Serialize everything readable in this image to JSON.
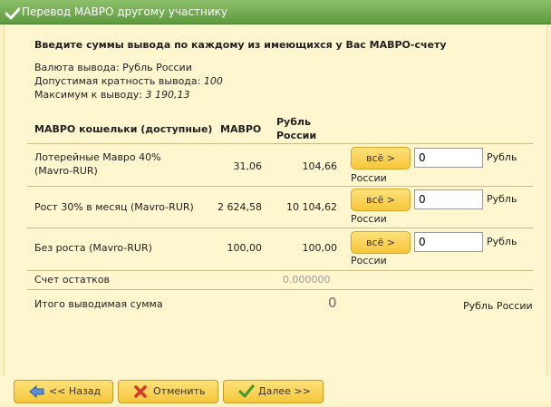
{
  "window": {
    "title": "Перевод МАВРО другому участнику"
  },
  "form": {
    "heading": "Введите суммы вывода по каждому из имеющихся у Вас МАВРО-счету",
    "currency_label": "Валюта вывода: Рубль России",
    "multiplicity_label": "Допустимая кратность вывода:",
    "multiplicity_value": "100",
    "maximum_label": "Максимум к выводу:",
    "maximum_value": "3 190,13"
  },
  "table": {
    "headers": {
      "wallets": "МАВРО кошельки (доступные)",
      "mavro": "МАВРО",
      "rub_line1": "Рубль",
      "rub_line2": "России"
    },
    "rows": [
      {
        "name_line1": "Лотерейные Мавро 40%",
        "name_line2": "(Mavro-RUR)",
        "mavro": "31,06",
        "rub": "104,66",
        "button": "всё >",
        "amount": "0",
        "currency_line1": "Рубль",
        "currency_line2": "России"
      },
      {
        "name_line1": "Рост 30% в месяц (Mavro-RUR)",
        "name_line2": "",
        "mavro": "2 624,58",
        "rub": "10 104,62",
        "button": "всё >",
        "amount": "0",
        "currency_line1": "Рубль",
        "currency_line2": "России"
      },
      {
        "name_line1": "Без роста (Mavro-RUR)",
        "name_line2": "",
        "mavro": "100,00",
        "rub": "100,00",
        "button": "всё >",
        "amount": "0",
        "currency_line1": "Рубль",
        "currency_line2": "России"
      }
    ],
    "balance": {
      "label": "Счет остатков",
      "value": "0.000000"
    },
    "total": {
      "label": "Итого выводимая сумма",
      "value": "0",
      "currency": "Рубль России"
    }
  },
  "buttons": {
    "back": "<< Назад",
    "cancel": "Отменить",
    "next": "Далее >>"
  },
  "colors": {
    "titlebar": "#6aa84f",
    "background": "#fdf6cf",
    "button": "#f8d15a"
  },
  "icons": {
    "title": "checkmark-icon",
    "back": "arrow-left-icon",
    "cancel": "red-x-icon",
    "next": "checkmark-icon"
  }
}
